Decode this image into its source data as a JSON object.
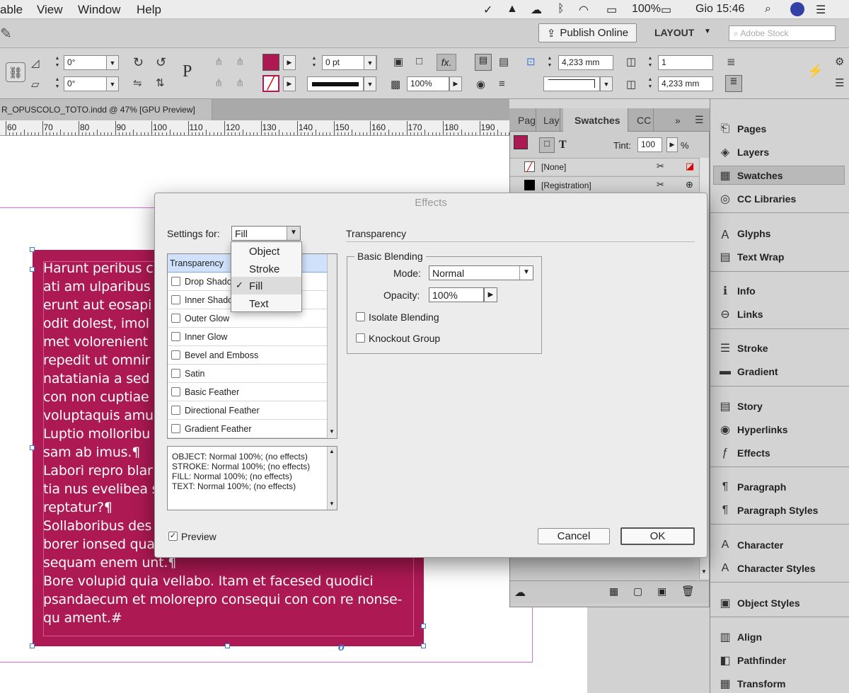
{
  "menubar": {
    "items": [
      "able",
      "View",
      "Window",
      "Help"
    ],
    "status": {
      "battery": "100%",
      "clock": "Gio 15:46"
    }
  },
  "appbar": {
    "publish_label": "Publish Online",
    "workspace_label": "LAYOUT",
    "search_placeholder": "Adobe Stock"
  },
  "controlbar": {
    "rotate_angle": "0°",
    "shear_angle": "0°",
    "stroke_weight": "0 pt",
    "opacity": "100%",
    "fx_label": "fx.",
    "width": "4,233 mm",
    "height": "4,233 mm",
    "columns": "1",
    "gutter": "4,233 mm",
    "para_glyph": "P"
  },
  "document": {
    "tab_title": "R_OPUSCOLO_TOTO.indd @ 47% [GPU Preview]",
    "ruler_labels": [
      "60",
      "70",
      "80",
      "90",
      "100",
      "110",
      "120",
      "130",
      "140",
      "150",
      "160",
      "170",
      "180",
      "190"
    ],
    "text_lines": [
      "Harunt peribus c",
      "ati am ulparibus",
      "erunt aut eosapi",
      "odit dolest, imol",
      "met volorenient",
      "repedit ut omnir",
      "natatiania a sed",
      "con non cuptiae",
      "voluptaquis amu",
      "Luptio molloribu",
      "sam ab imus.¶",
      "Labori repro blar",
      "tia nus evelibea s",
      "reptatur?¶",
      "Sollaboribus des",
      "borer ionsed qua",
      "sequam enem unt.¶",
      "Bore volupid quia vellabo. Itam et facesed quodici",
      "psandaecum et molorepro consequi con con re nonse-",
      "qu ament.#"
    ],
    "overflow_glyph": "o"
  },
  "swatches": {
    "tabs": [
      "Pag",
      "Lay",
      "Swatches",
      "CC"
    ],
    "tint_label": "Tint:",
    "tint_value": "100",
    "tint_unit": "%",
    "type_glyph": "T",
    "rows": [
      "[None]",
      "[Registration]"
    ]
  },
  "dock": {
    "items": [
      "Pages",
      "Layers",
      "Swatches",
      "CC Libraries",
      "Glyphs",
      "Text Wrap",
      "Info",
      "Links",
      "Stroke",
      "Gradient",
      "Story",
      "Hyperlinks",
      "Effects",
      "Paragraph",
      "Paragraph Styles",
      "Character",
      "Character Styles",
      "Object Styles",
      "Align",
      "Pathfinder",
      "Transform"
    ],
    "icons": [
      "pages-icon",
      "layers-icon",
      "swatches-icon",
      "cc-libraries-icon",
      "glyphs-icon",
      "text-wrap-icon",
      "info-icon",
      "links-icon",
      "stroke-icon",
      "gradient-icon",
      "story-icon",
      "hyperlinks-icon",
      "effects-icon",
      "paragraph-icon",
      "paragraph-styles-icon",
      "character-icon",
      "character-styles-icon",
      "object-styles-icon",
      "align-icon",
      "pathfinder-icon",
      "transform-icon"
    ]
  },
  "dialog": {
    "title": "Effects",
    "settings_for_label": "Settings for:",
    "settings_for_value": "Fill",
    "section_title": "Transparency",
    "group_title": "Basic Blending",
    "mode_label": "Mode:",
    "mode_value": "Normal",
    "opacity_label": "Opacity:",
    "opacity_value": "100%",
    "isolate_label": "Isolate Blending",
    "knockout_label": "Knockout Group",
    "effects": [
      "Transparency",
      "Drop Shado",
      "Inner Shado",
      "Outer Glow",
      "Inner Glow",
      "Bevel and Emboss",
      "Satin",
      "Basic Feather",
      "Directional Feather",
      "Gradient Feather"
    ],
    "summary": [
      "OBJECT: Normal 100%; (no effects)",
      "STROKE: Normal 100%; (no effects)",
      "FILL: Normal 100%; (no effects)",
      "TEXT: Normal 100%; (no effects)"
    ],
    "preview_label": "Preview",
    "cancel_label": "Cancel",
    "ok_label": "OK",
    "menu_options": [
      "Object",
      "Stroke",
      "Fill",
      "Text"
    ],
    "selected_option": "Fill"
  },
  "colors": {
    "accent": "#ad1953",
    "selection": "#3879d9"
  }
}
